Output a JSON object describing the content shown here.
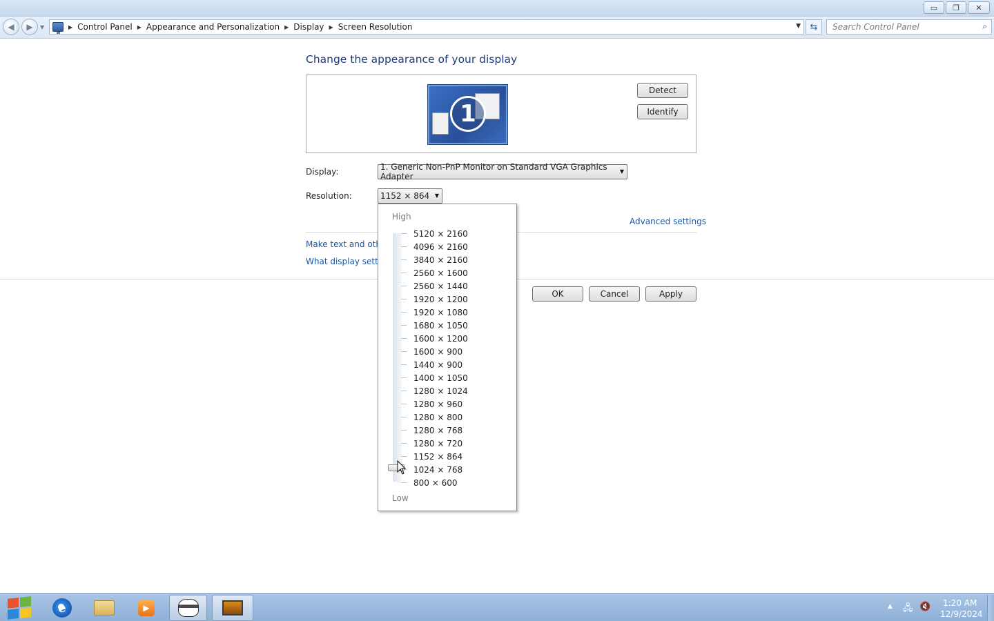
{
  "window": {
    "buttons": {
      "minimize": "▭",
      "restore": "❐",
      "close": "✕"
    }
  },
  "address": {
    "breadcrumbs": [
      "Control Panel",
      "Appearance and Personalization",
      "Display",
      "Screen Resolution"
    ],
    "search_placeholder": "Search Control Panel"
  },
  "main": {
    "heading": "Change the appearance of your display",
    "monitor_number": "1",
    "detect_label": "Detect",
    "identify_label": "Identify",
    "display_label": "Display:",
    "display_value": "1. Generic Non-PnP Monitor on Standard VGA Graphics Adapter",
    "resolution_label": "Resolution:",
    "resolution_value": "1152 × 864",
    "advanced_link": "Advanced settings",
    "link_text_size": "Make text and other",
    "link_display_settings": "What display setting",
    "ok_label": "OK",
    "cancel_label": "Cancel",
    "apply_label": "Apply"
  },
  "dropdown": {
    "high_label": "High",
    "low_label": "Low",
    "options": [
      "5120 × 2160",
      "4096 × 2160",
      "3840 × 2160",
      "2560 × 1600",
      "2560 × 1440",
      "1920 × 1200",
      "1920 × 1080",
      "1680 × 1050",
      "1600 × 1200",
      "1600 × 900",
      "1440 × 900",
      "1400 × 1050",
      "1280 × 1024",
      "1280 × 960",
      "1280 × 800",
      "1280 × 768",
      "1280 × 720",
      "1152 × 864",
      "1024 × 768",
      "800 × 600"
    ],
    "slider_selected": "1024 × 768"
  },
  "taskbar": {
    "time": "1:20 AM",
    "date": "12/9/2024",
    "tray_up": "▲"
  },
  "colors": {
    "heading": "#1e3a76",
    "link": "#1b57a3",
    "taskbar": "#9bb7dc"
  }
}
